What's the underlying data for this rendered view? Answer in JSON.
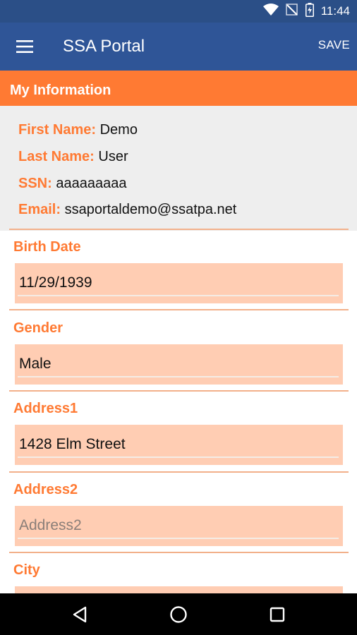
{
  "status_bar": {
    "time": "11:44",
    "icons": [
      "wifi-icon",
      "no-signal-icon",
      "battery-icon"
    ]
  },
  "app_bar": {
    "title": "SSA Portal",
    "save_label": "SAVE",
    "menu_icon": "menu-icon"
  },
  "section": {
    "title": "My Information"
  },
  "info": {
    "first_name_label": "First Name:",
    "first_name_value": "Demo",
    "last_name_label": "Last Name:",
    "last_name_value": "User",
    "ssn_label": "SSN:",
    "ssn_value": "aaaaaaaaa",
    "email_label": "Email:",
    "email_value": "ssaportaldemo@ssatpa.net"
  },
  "fields": {
    "birth_date": {
      "label": "Birth Date",
      "value": "11/29/1939"
    },
    "gender": {
      "label": "Gender",
      "value": "Male"
    },
    "address1": {
      "label": "Address1",
      "value": "1428 Elm Street"
    },
    "address2": {
      "label": "Address2",
      "placeholder": "Address2"
    },
    "city": {
      "label": "City"
    }
  },
  "nav": {
    "icons": [
      "back-icon",
      "home-icon",
      "recents-icon"
    ]
  },
  "colors": {
    "app_bar": "#2f5597",
    "status_bar": "#2b4f87",
    "accent": "#ff7a33",
    "field_bg": "#ffcdb3",
    "info_bg": "#eeeeee"
  }
}
